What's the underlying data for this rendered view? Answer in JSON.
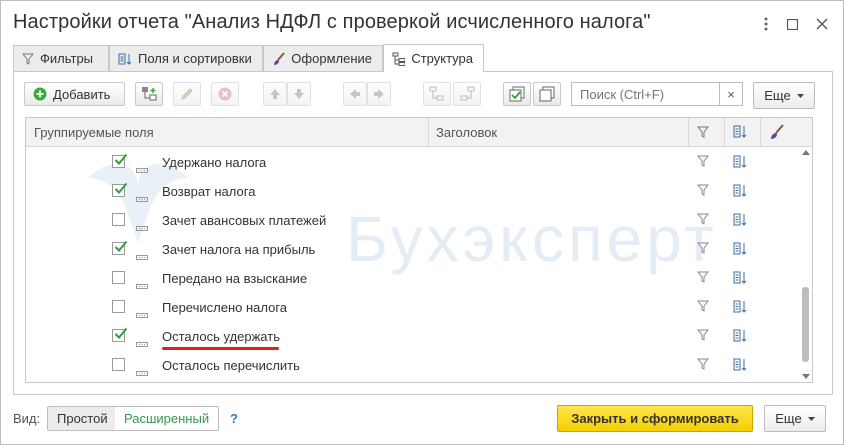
{
  "window": {
    "title": "Настройки отчета \"Анализ НДФЛ с проверкой исчисленного налога\""
  },
  "tabs": [
    {
      "label": "Фильтры",
      "icon": "filter-icon",
      "active": false
    },
    {
      "label": "Поля и сортировки",
      "icon": "fields-sort-icon",
      "active": false
    },
    {
      "label": "Оформление",
      "icon": "brush-icon",
      "active": false
    },
    {
      "label": "Структура",
      "icon": "structure-icon",
      "active": true
    }
  ],
  "toolbar": {
    "add_label": "Добавить",
    "search_placeholder": "Поиск (Ctrl+F)",
    "search_clear": "×",
    "more_label": "Еще"
  },
  "grid": {
    "columns": {
      "fields": "Группируемые поля",
      "header": "Заголовок"
    },
    "rows": [
      {
        "label": "Удержано налога",
        "checked": true,
        "underlined": false
      },
      {
        "label": "Возврат налога",
        "checked": true,
        "underlined": false
      },
      {
        "label": "Зачет авансовых платежей",
        "checked": false,
        "underlined": false
      },
      {
        "label": "Зачет налога на прибыль",
        "checked": true,
        "underlined": false
      },
      {
        "label": "Передано на взыскание",
        "checked": false,
        "underlined": false
      },
      {
        "label": "Перечислено налога",
        "checked": false,
        "underlined": false
      },
      {
        "label": "Осталось удержать",
        "checked": true,
        "underlined": true
      },
      {
        "label": "Осталось перечислить",
        "checked": false,
        "underlined": false
      }
    ]
  },
  "watermark": "Бухэксперт",
  "bottom": {
    "view_label": "Вид:",
    "simple": "Простой",
    "extended": "Расширенный",
    "help": "?",
    "primary": "Закрыть и сформировать",
    "more": "Еще"
  },
  "colors": {
    "primary": "#f5cf00",
    "check": "#2e9e3a",
    "underline": "#e02020",
    "extended_text": "#2f9a4b",
    "watermark": "#e4ecf5"
  }
}
